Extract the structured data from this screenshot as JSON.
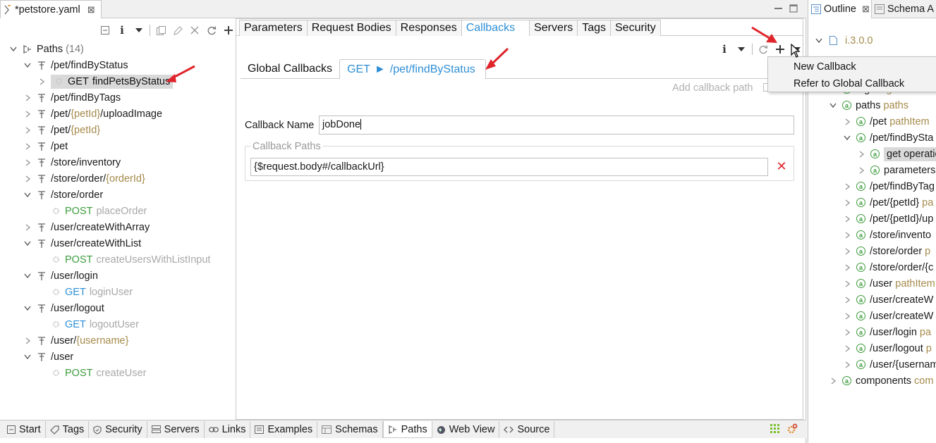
{
  "editor": {
    "tab_title": "*petstore.yaml",
    "close_glyph": "⊠"
  },
  "tree": {
    "root_label": "Paths",
    "root_count": "(14)",
    "rows": [
      {
        "kind": "path",
        "expanded": true,
        "parts": [
          {
            "t": "/pet/findByStatus"
          }
        ]
      },
      {
        "kind": "op",
        "selected": true,
        "method": "GET",
        "name": "findPetsByStatus"
      },
      {
        "kind": "path",
        "expanded": false,
        "parts": [
          {
            "t": "/pet/findByTags"
          }
        ]
      },
      {
        "kind": "path",
        "expanded": false,
        "parts": [
          {
            "t": "/pet/"
          },
          {
            "t": "{petId}",
            "p": true
          },
          {
            "t": "/uploadImage"
          }
        ]
      },
      {
        "kind": "path",
        "expanded": false,
        "parts": [
          {
            "t": "/pet/"
          },
          {
            "t": "{petId}",
            "p": true
          }
        ]
      },
      {
        "kind": "path",
        "expanded": false,
        "parts": [
          {
            "t": "/pet"
          }
        ]
      },
      {
        "kind": "path",
        "expanded": false,
        "parts": [
          {
            "t": "/store/inventory"
          }
        ]
      },
      {
        "kind": "path",
        "expanded": false,
        "parts": [
          {
            "t": "/store/order/"
          },
          {
            "t": "{orderId}",
            "p": true
          }
        ]
      },
      {
        "kind": "path",
        "expanded": true,
        "parts": [
          {
            "t": "/store/order"
          }
        ]
      },
      {
        "kind": "op",
        "method": "POST",
        "name": "placeOrder"
      },
      {
        "kind": "path",
        "expanded": false,
        "parts": [
          {
            "t": "/user/createWithArray"
          }
        ]
      },
      {
        "kind": "path",
        "expanded": true,
        "parts": [
          {
            "t": "/user/createWithList"
          }
        ]
      },
      {
        "kind": "op",
        "method": "POST",
        "name": "createUsersWithListInput"
      },
      {
        "kind": "path",
        "expanded": true,
        "parts": [
          {
            "t": "/user/login"
          }
        ]
      },
      {
        "kind": "op",
        "method": "GET",
        "name": "loginUser"
      },
      {
        "kind": "path",
        "expanded": true,
        "parts": [
          {
            "t": "/user/logout"
          }
        ]
      },
      {
        "kind": "op",
        "method": "GET",
        "name": "logoutUser"
      },
      {
        "kind": "path",
        "expanded": false,
        "parts": [
          {
            "t": "/user/"
          },
          {
            "t": "{username}",
            "p": true
          }
        ]
      },
      {
        "kind": "path",
        "expanded": true,
        "parts": [
          {
            "t": "/user"
          }
        ]
      },
      {
        "kind": "op",
        "method": "POST",
        "name": "createUser"
      }
    ]
  },
  "detail": {
    "tabs": [
      "Parameters",
      "Request Bodies",
      "Responses",
      "Callbacks",
      "Servers",
      "Tags",
      "Security"
    ],
    "active_tab": "Callbacks",
    "subtab_global": "Global Callbacks",
    "subtab_active_method": "GET",
    "subtab_active_arrow": "►",
    "subtab_active_path": "/pet/findByStatus",
    "add_callback_path": "Add callback path",
    "callback_name_label": "Callback Name",
    "callback_name_value": "jobDone",
    "callback_paths_legend": "Callback Paths",
    "callback_path_value": "{$request.body#/callbackUrl}",
    "delete_glyph": "✕"
  },
  "menu": {
    "items": [
      "New Callback",
      "Refer to Global Callback"
    ]
  },
  "outline": {
    "tab_outline": "Outline",
    "tab_schema": "Schema A",
    "rows": [
      {
        "indent": 0,
        "tw": "down",
        "doc": true,
        "label": "",
        "type": "i.3.0.0"
      },
      {
        "indent": 1,
        "tw": "",
        "label": "",
        "type": ""
      },
      {
        "indent": 1,
        "tw": "right",
        "label": "servers",
        "type": "servers"
      },
      {
        "indent": 1,
        "tw": "right",
        "label": "tags",
        "type": "tags"
      },
      {
        "indent": 1,
        "tw": "down",
        "label": "paths",
        "type": "paths"
      },
      {
        "indent": 2,
        "tw": "right",
        "label": "/pet",
        "type": "pathItem"
      },
      {
        "indent": 2,
        "tw": "down",
        "label": "/pet/findBySta",
        "type": ""
      },
      {
        "indent": 3,
        "tw": "right",
        "label": "get operatio",
        "type": "",
        "selected": true
      },
      {
        "indent": 3,
        "tw": "right",
        "label": "parameters",
        "type": ""
      },
      {
        "indent": 2,
        "tw": "right",
        "label": "/pet/findByTag",
        "type": ""
      },
      {
        "indent": 2,
        "tw": "right",
        "label": "/pet/{petId}",
        "type": "pa"
      },
      {
        "indent": 2,
        "tw": "right",
        "label": "/pet/{petId}/up",
        "type": ""
      },
      {
        "indent": 2,
        "tw": "right",
        "label": "/store/invento",
        "type": ""
      },
      {
        "indent": 2,
        "tw": "right",
        "label": "/store/order",
        "type": "p"
      },
      {
        "indent": 2,
        "tw": "right",
        "label": "/store/order/{c",
        "type": ""
      },
      {
        "indent": 2,
        "tw": "right",
        "label": "/user",
        "type": "pathItem"
      },
      {
        "indent": 2,
        "tw": "right",
        "label": "/user/createW",
        "type": ""
      },
      {
        "indent": 2,
        "tw": "right",
        "label": "/user/createW",
        "type": ""
      },
      {
        "indent": 2,
        "tw": "right",
        "label": "/user/login",
        "type": "pa"
      },
      {
        "indent": 2,
        "tw": "right",
        "label": "/user/logout",
        "type": "p"
      },
      {
        "indent": 2,
        "tw": "right",
        "label": "/user/{usernam",
        "type": ""
      },
      {
        "indent": 1,
        "tw": "right",
        "label": "components",
        "type": "com"
      }
    ]
  },
  "bottom_tabs": [
    {
      "label": "Start",
      "icon": "start-icon"
    },
    {
      "label": "Tags",
      "icon": "tag-icon"
    },
    {
      "label": "Security",
      "icon": "shield-icon"
    },
    {
      "label": "Servers",
      "icon": "server-icon"
    },
    {
      "label": "Links",
      "icon": "link-icon"
    },
    {
      "label": "Examples",
      "icon": "examples-icon"
    },
    {
      "label": "Schemas",
      "icon": "schemas-icon"
    },
    {
      "label": "Paths",
      "icon": "paths-icon",
      "active": true
    },
    {
      "label": "Web View",
      "icon": "globe-icon"
    },
    {
      "label": "Source",
      "icon": "source-icon"
    }
  ],
  "colors": {
    "accent": "#2f8fd6",
    "post": "#3c9b3c",
    "param": "#a58a4a",
    "annotation_arrow": "#e0242c"
  }
}
